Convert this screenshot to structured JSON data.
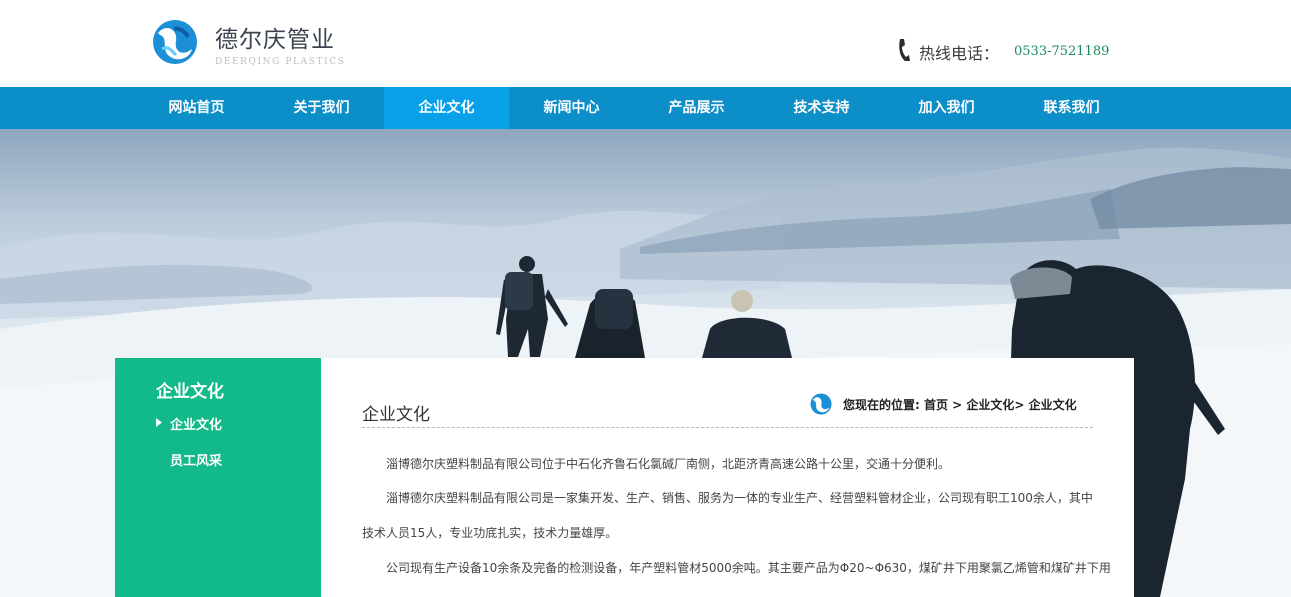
{
  "header": {
    "logo_title": "德尔庆管业",
    "logo_subtitle": "DEERQING PLASTICS",
    "hotline_label": "热线电话：",
    "hotline_number": "0533-7521189"
  },
  "nav": {
    "items": [
      {
        "label": "网站首页"
      },
      {
        "label": "关于我们"
      },
      {
        "label": "企业文化",
        "active": true
      },
      {
        "label": "新闻中心"
      },
      {
        "label": "产品展示"
      },
      {
        "label": "技术支持"
      },
      {
        "label": "加入我们"
      },
      {
        "label": "联系我们"
      }
    ]
  },
  "sidebar": {
    "title": "企业文化",
    "items": [
      {
        "label": "企业文化",
        "active": true
      },
      {
        "label": "员工风采"
      }
    ]
  },
  "content": {
    "title": "企业文化",
    "location_label": "您现在的位置:",
    "breadcrumb": "首页 > 企业文化> 企业文化",
    "paragraphs": [
      "淄博德尔庆塑料制品有限公司位于中石化齐鲁石化氯碱厂南侧，北距济青高速公路十公里，交通十分便利。",
      "淄博德尔庆塑料制品有限公司是一家集开发、生产、销售、服务为一体的专业生产、经营塑料管材企业，公司现有职工100余人，其中技术人员15人，专业功底扎实，技术力量雄厚。",
      "公司现有生产设备10余条及完备的检测设备，年产塑料管材5000余吨。其主要产品为Φ20~Φ630，煤矿井下用聚氯乙烯管和煤矿井下用"
    ]
  },
  "colors": {
    "nav_bg": "#0c8ec8",
    "nav_active": "#0aa0e8",
    "sidebar_bg": "#12b98a",
    "hotline": "#1a8a5c"
  },
  "icons": [
    "logo-icon",
    "phone-icon",
    "location-logo-icon",
    "arrow-right-icon"
  ]
}
